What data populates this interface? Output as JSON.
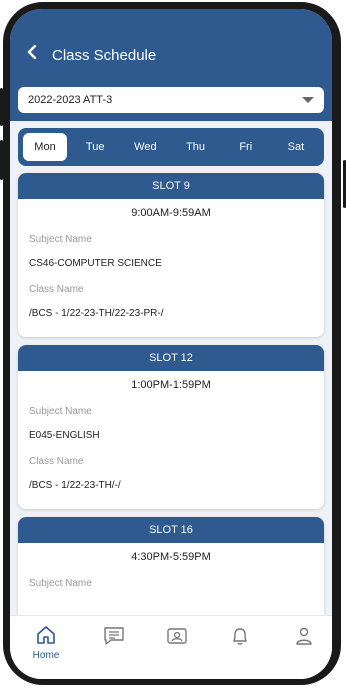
{
  "header": {
    "title": "Class Schedule"
  },
  "term_select": {
    "value": "2022-2023 ATT-3"
  },
  "days": [
    "Mon",
    "Tue",
    "Wed",
    "Thu",
    "Fri",
    "Sat"
  ],
  "selected_day": "Mon",
  "slots": [
    {
      "title": "SLOT 9",
      "time": "9:00AM-9:59AM",
      "subject_label": "Subject Name",
      "subject": "CS46-COMPUTER SCIENCE",
      "class_label": "Class Name",
      "class": "/BCS - 1/22-23-TH/22-23-PR-/"
    },
    {
      "title": "SLOT 12",
      "time": "1:00PM-1:59PM",
      "subject_label": "Subject Name",
      "subject": "E045-ENGLISH",
      "class_label": "Class Name",
      "class": "/BCS - 1/22-23-TH/-/"
    },
    {
      "title": "SLOT 16",
      "time": "4:30PM-5:59PM",
      "subject_label": "Subject Name"
    }
  ],
  "bottom_nav": {
    "home_label": "Home"
  },
  "colors": {
    "primary": "#2e5a8f",
    "background": "#eef1f5"
  }
}
